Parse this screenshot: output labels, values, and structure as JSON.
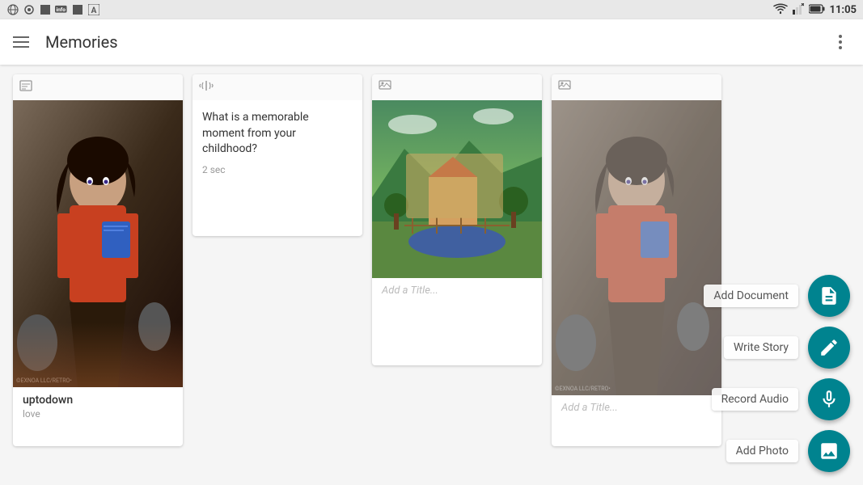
{
  "statusBar": {
    "time": "11:05",
    "icons": [
      "wifi",
      "signal",
      "battery"
    ]
  },
  "appBar": {
    "title": "Memories",
    "menuIcon": "hamburger",
    "moreIcon": "more-vertical"
  },
  "cards": [
    {
      "id": "card-1",
      "type": "image",
      "typeIcon": "📝",
      "title": "",
      "subtitle": "",
      "name": "uptodown",
      "tag": "love",
      "hasImage": true,
      "imageType": "anime-character"
    },
    {
      "id": "card-2",
      "type": "audio",
      "typeIcon": "🎧",
      "storyText": "What is a memorable moment from your childhood?",
      "timestamp": "2 sec"
    },
    {
      "id": "card-3",
      "type": "photo",
      "typeIcon": "🖼️",
      "addTitlePlaceholder": "Add a Title...",
      "hasImage": true,
      "imageType": "game-screenshot"
    },
    {
      "id": "card-4",
      "type": "photo",
      "typeIcon": "🖼️",
      "addTitlePlaceholder": "Add a Title...",
      "hasImage": true,
      "imageType": "anime-character-2"
    }
  ],
  "fabMenu": {
    "items": [
      {
        "id": "add-document",
        "label": "Add Document",
        "icon": "document"
      },
      {
        "id": "write-story",
        "label": "Write Story",
        "icon": "text-align"
      },
      {
        "id": "record-audio",
        "label": "Record Audio",
        "icon": "microphone"
      },
      {
        "id": "add-photo",
        "label": "Add Photo",
        "icon": "image"
      }
    ]
  }
}
